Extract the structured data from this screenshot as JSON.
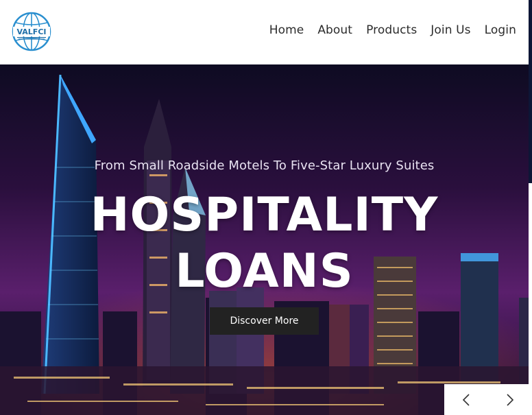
{
  "logo": {
    "text": "VALFCI",
    "icon": "globe-logo"
  },
  "nav": {
    "items": [
      "Home",
      "About",
      "Products",
      "Join Us",
      "Login"
    ]
  },
  "hero": {
    "subtitle": "From Small Roadside Motels To Five-Star Luxury Suites",
    "title_line1": "HOSPITALITY",
    "title_line2": "LOANS",
    "cta_label": "Discover More"
  },
  "slider": {
    "prev_icon": "chevron-left-icon",
    "next_icon": "chevron-right-icon"
  },
  "colors": {
    "header_bg": "#ffffff",
    "cta_bg": "#222222",
    "hero_sky": "#2a0f3d",
    "logo_blue": "#2a8fcf"
  }
}
